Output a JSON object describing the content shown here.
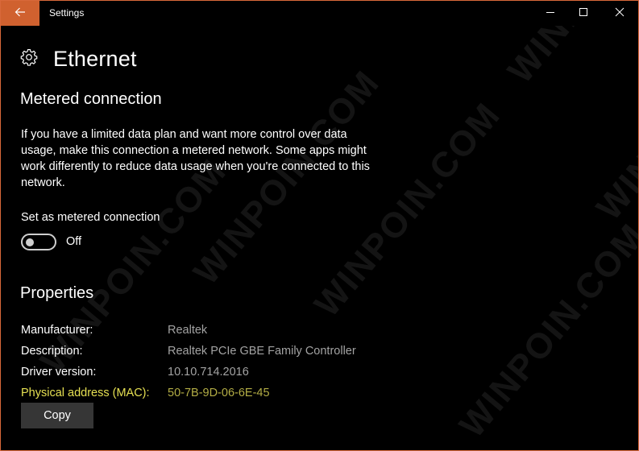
{
  "window": {
    "title": "Settings",
    "accent_color": "#d0612f",
    "controls": {
      "minimize": "minimize-icon",
      "maximize": "maximize-icon",
      "close": "close-icon"
    },
    "back_icon": "arrow-left-icon"
  },
  "page": {
    "icon": "gear-icon",
    "title": "Ethernet"
  },
  "metered": {
    "heading": "Metered connection",
    "description": "If you have a limited data plan and want more control over data usage, make this connection a metered network. Some apps might work differently to reduce data usage when you're connected to this network.",
    "toggle_label": "Set as metered connection",
    "toggle_state": "Off",
    "toggle_on": false
  },
  "properties": {
    "heading": "Properties",
    "rows": [
      {
        "label": "Manufacturer:",
        "value": "Realtek"
      },
      {
        "label": "Description:",
        "value": "Realtek PCIe GBE Family Controller"
      },
      {
        "label": "Driver version:",
        "value": "10.10.714.2016"
      },
      {
        "label": "Physical address (MAC):",
        "value": "50-7B-9D-06-6E-45",
        "highlighted": true
      }
    ],
    "copy_label": "Copy",
    "highlight_color": "#e6e052"
  },
  "watermark": "WINPOIN.COM"
}
